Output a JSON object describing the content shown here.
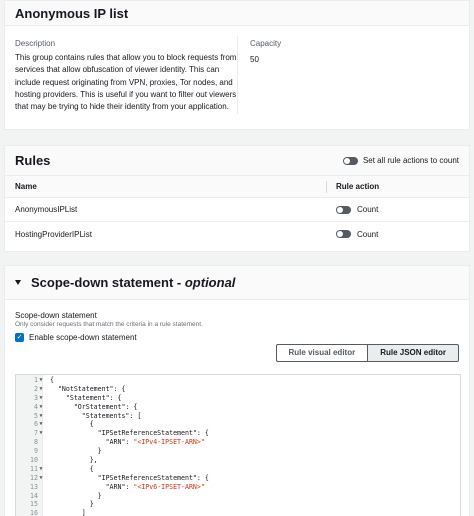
{
  "group_panel": {
    "title": "Anonymous IP list",
    "description_label": "Description",
    "description_text": "This group contains rules that allow you to block requests from services that allow obfuscation of viewer identity. This can include request originating from VPN, proxies, Tor nodes, and hosting providers. This is useful if you want to filter out viewers that may be trying to hide their identity from your application.",
    "capacity_label": "Capacity",
    "capacity_value": "50"
  },
  "rules_panel": {
    "title": "Rules",
    "set_all_label": "Set all rule actions to count",
    "columns": [
      "Name",
      "Rule action"
    ],
    "rows": [
      {
        "name": "AnonymousIPList",
        "action": "Count"
      },
      {
        "name": "HostingProviderIPList",
        "action": "Count"
      }
    ]
  },
  "scope_panel": {
    "title": "Scope-down statement",
    "title_optional": "optional",
    "title_separator": " - ",
    "statement_label": "Scope-down statement",
    "statement_sub": "Only consider requests that match the criteria in a rule statement.",
    "enable_label": "Enable scope-down statement",
    "enable_checked": true,
    "editor_tabs": [
      "Rule visual editor",
      "Rule JSON editor"
    ],
    "active_tab": "Rule JSON editor",
    "code_lines": [
      {
        "n": "1",
        "fold": true,
        "text": "{"
      },
      {
        "n": "2",
        "fold": true,
        "text": "  \"NotStatement\": {"
      },
      {
        "n": "3",
        "fold": true,
        "text": "    \"Statement\": {"
      },
      {
        "n": "4",
        "fold": true,
        "text": "      \"OrStatement\": {"
      },
      {
        "n": "5",
        "fold": true,
        "text": "        \"Statements\": ["
      },
      {
        "n": "6",
        "fold": true,
        "text": "          {"
      },
      {
        "n": "7",
        "fold": true,
        "text": "            \"IPSetReferenceStatement\": {"
      },
      {
        "n": "8",
        "fold": false,
        "text": "              \"ARN\": ",
        "str": "\"<IPv4-IPSET-ARN>\""
      },
      {
        "n": "9",
        "fold": false,
        "text": "            }"
      },
      {
        "n": "10",
        "fold": false,
        "text": "          },"
      },
      {
        "n": "11",
        "fold": true,
        "text": "          {"
      },
      {
        "n": "12",
        "fold": true,
        "text": "            \"IPSetReferenceStatement\": {"
      },
      {
        "n": "13",
        "fold": false,
        "text": "              \"ARN\": ",
        "str": "\"<IPv6-IPSET-ARN>\""
      },
      {
        "n": "14",
        "fold": false,
        "text": "            }"
      },
      {
        "n": "15",
        "fold": false,
        "text": "          }"
      },
      {
        "n": "16",
        "fold": false,
        "text": "        ]"
      }
    ]
  },
  "colors": {
    "accent": "#0073bb",
    "string": "#d13212",
    "toggle_off": "#545b64"
  },
  "icons": {
    "expand": "caret-down-icon",
    "checkbox": "checkmark-icon",
    "toggle": "toggle-switch-icon"
  }
}
